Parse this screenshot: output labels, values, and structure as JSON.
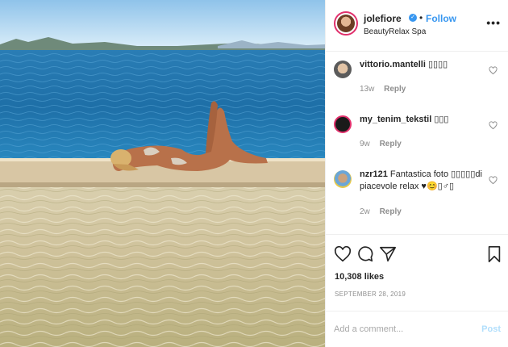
{
  "post": {
    "photo_alt": "",
    "owner": {
      "username": "jolefiore",
      "verified": true,
      "location": "BeautyRelax Spa",
      "follow_label": "Follow",
      "separator": "•",
      "more_label": "•••"
    },
    "comments": [
      {
        "username": "vittorio.mantelli",
        "text": "▯▯▯▯",
        "time": "13w",
        "reply_label": "Reply"
      },
      {
        "username": "my_tenim_tekstil",
        "text": "▯▯▯",
        "time": "9w",
        "reply_label": "Reply"
      },
      {
        "username": "nzr121",
        "text": "Fantastica foto ▯▯▯▯▯di piacevole relax ♥😊▯♂▯",
        "time": "2w",
        "reply_label": "Reply"
      }
    ],
    "likes": "10,308 likes",
    "date": "SEPTEMBER 28, 2019",
    "add_comment": {
      "placeholder": "Add a comment...",
      "post_label": "Post"
    }
  },
  "colors": {
    "accent": "#3897f0",
    "post_disabled": "#b2dffc",
    "secondary_text": "#8e8e8e"
  },
  "icons": [
    "verified-badge-icon",
    "more-options-icon",
    "heart-icon",
    "comment-icon",
    "share-icon",
    "bookmark-icon"
  ]
}
